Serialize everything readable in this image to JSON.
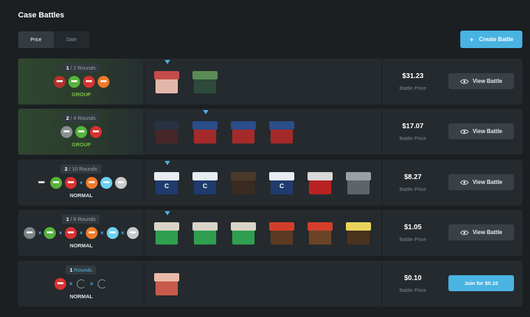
{
  "page": {
    "title": "Case Battles"
  },
  "sort": {
    "tabs": [
      "Price",
      "Date"
    ],
    "active": "Price"
  },
  "actions": {
    "create_label": "Create Battle",
    "create_icon": "plus-icon"
  },
  "colors": {
    "accent": "#49b3e2",
    "group": "#7cc04a",
    "row_bg": "#242a2e",
    "page_bg": "#1b1f22"
  },
  "battles": [
    {
      "rounds_current": "1",
      "rounds_total": "2",
      "rounds_suffix": "Rounds",
      "mode": "GROUP",
      "price": "$31.23",
      "price_caption": "Battle Price",
      "action": "View Battle",
      "action_icon": "eye-icon",
      "players": [
        "#b5312b",
        "#57b33c",
        "#d93131",
        "#f07a28"
      ],
      "separators": [],
      "current_case": 0,
      "cases": [
        {
          "lid": "#c44c4c",
          "body": "#e2b7a9",
          "mark": ""
        },
        {
          "lid": "#5b8c55",
          "body": "#2d4a3a",
          "mark": ""
        }
      ]
    },
    {
      "rounds_current": "2",
      "rounds_total": "4",
      "rounds_suffix": "Rounds",
      "mode": "GROUP",
      "price": "$17.07",
      "price_caption": "Battle Price",
      "action": "View Battle",
      "action_icon": "eye-icon",
      "players": [
        "#8a8f92",
        "#57b33c",
        "#d93131"
      ],
      "separators": [],
      "current_case": 1,
      "cases": [
        {
          "lid": "#2b3f66",
          "body": "#8a1f1f",
          "mark": ""
        },
        {
          "lid": "#2b4d8a",
          "body": "#a42a2a",
          "mark": ""
        },
        {
          "lid": "#2b4d8a",
          "body": "#a42a2a",
          "mark": ""
        },
        {
          "lid": "#2b4d8a",
          "body": "#a42a2a",
          "mark": ""
        }
      ]
    },
    {
      "rounds_current": "2",
      "rounds_total": "10",
      "rounds_suffix": "Rounds",
      "mode": "NORMAL",
      "price": "$8.27",
      "price_caption": "Battle Price",
      "action": "View Battle",
      "action_icon": "eye-icon",
      "players": [
        "#2a2a2a",
        "#57b33c",
        "#d93131",
        "#f07a28",
        "#6fd0f0",
        "#c9c9c9"
      ],
      "separators": [
        2
      ],
      "current_case": 0,
      "cases": [
        {
          "lid": "#e8edf1",
          "body": "#1f3b6e",
          "mark": "C"
        },
        {
          "lid": "#e8edf1",
          "body": "#1f3b6e",
          "mark": "C"
        },
        {
          "lid": "#4a3a2a",
          "body": "#3b2b1e",
          "mark": ""
        },
        {
          "lid": "#e8edf1",
          "body": "#1f3b6e",
          "mark": "C"
        },
        {
          "lid": "#d8d8d8",
          "body": "#b82222",
          "mark": ""
        },
        {
          "lid": "#9aa0a4",
          "body": "#5e6468",
          "mark": ""
        }
      ]
    },
    {
      "rounds_current": "1",
      "rounds_total": "6",
      "rounds_suffix": "Rounds",
      "mode": "NORMAL",
      "price": "$1.05",
      "price_caption": "Battle Price",
      "action": "View Battle",
      "action_icon": "eye-icon",
      "players": [
        "#7d8589",
        "#57b33c",
        "#d93131",
        "#f07a28",
        "#6fd0f0",
        "#c9c9c9"
      ],
      "separators": [
        0,
        1,
        2,
        3,
        4
      ],
      "current_case": 0,
      "cases": [
        {
          "lid": "#d9d4c8",
          "body": "#2f9e4f",
          "mark": ""
        },
        {
          "lid": "#d9d4c8",
          "body": "#2f9e4f",
          "mark": ""
        },
        {
          "lid": "#d9d4c8",
          "body": "#2f9e4f",
          "mark": ""
        },
        {
          "lid": "#d33e2a",
          "body": "#5a3a22",
          "mark": ""
        },
        {
          "lid": "#d33e2a",
          "body": "#6b4426",
          "mark": ""
        },
        {
          "lid": "#e8d35a",
          "body": "#4a321e",
          "mark": ""
        }
      ]
    },
    {
      "rounds_current": "1",
      "rounds_total": "",
      "rounds_suffix": "Rounds",
      "mode": "NORMAL",
      "price": "$0.10",
      "price_caption": "Battle Price",
      "action": "Join for $0.10",
      "action_icon": "",
      "players": [
        "#d93131"
      ],
      "separators": [
        0,
        1
      ],
      "empty_slots": 2,
      "current_case": -1,
      "cases": [
        {
          "lid": "#e9b9a9",
          "body": "#c75a4a",
          "mark": ""
        }
      ]
    }
  ]
}
